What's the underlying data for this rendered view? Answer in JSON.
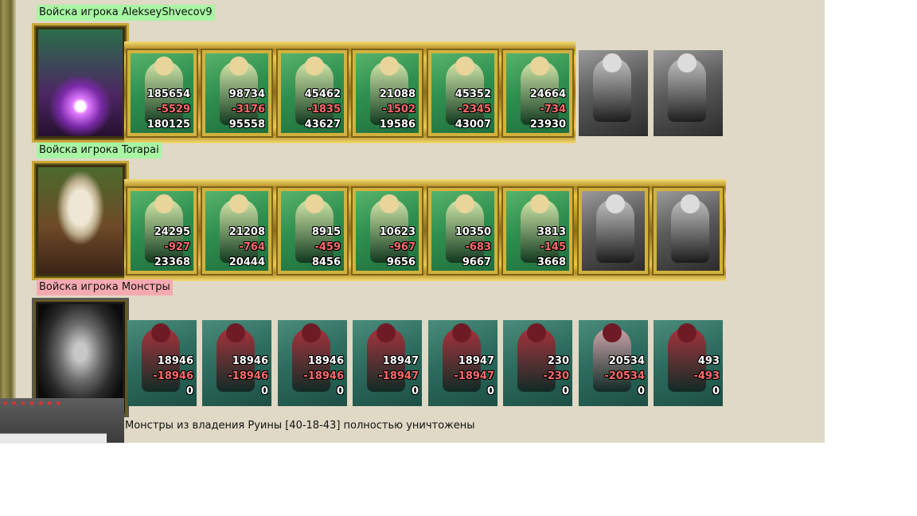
{
  "colors": {
    "panel_bg": "#dfd9c5",
    "label_green": "#a8f5a4",
    "label_pink": "#f5aab0",
    "number_white": "#ffffff",
    "number_red": "#ff6a6a",
    "gold_frame": "#d2b23d"
  },
  "armies": [
    {
      "label": "Войска игрока AlekseyShvecov9",
      "label_color": "green",
      "portrait_icon": "dark-elf-hero-portrait-icon",
      "units": [
        {
          "icon": "dwarf-warrior-icon",
          "start": "185654",
          "loss": "-5529",
          "left": "180125",
          "framed": true
        },
        {
          "icon": "blade-dancer-icon",
          "start": "98734",
          "loss": "-3176",
          "left": "95558",
          "framed": true
        },
        {
          "icon": "elf-guardian-icon",
          "start": "45462",
          "loss": "-1835",
          "left": "43627",
          "framed": true
        },
        {
          "icon": "griffin-icon",
          "start": "21088",
          "loss": "-1502",
          "left": "19586",
          "framed": true
        },
        {
          "icon": "elf-archer-icon",
          "start": "45352",
          "loss": "-2345",
          "left": "43007",
          "framed": true
        },
        {
          "icon": "druid-icon",
          "start": "24664",
          "loss": "-734",
          "left": "23930",
          "framed": true
        },
        {
          "icon": "monk-unit-grey-icon",
          "framed": false
        },
        {
          "icon": "elder-druid-grey-icon",
          "framed": false
        }
      ]
    },
    {
      "label": "Войска игрока Torapai",
      "label_color": "green",
      "portrait_icon": "barbarian-skull-hero-portrait-icon",
      "units": [
        {
          "icon": "dwarf-warrior-icon",
          "start": "24295",
          "loss": "-927",
          "left": "23368",
          "framed": true
        },
        {
          "icon": "blade-dancer-icon",
          "start": "21208",
          "loss": "-764",
          "left": "20444",
          "framed": true
        },
        {
          "icon": "elf-guardian-icon",
          "start": "8915",
          "loss": "-459",
          "left": "8456",
          "framed": true
        },
        {
          "icon": "griffin-icon",
          "start": "10623",
          "loss": "-967",
          "left": "9656",
          "framed": true
        },
        {
          "icon": "elf-archer-icon",
          "start": "10350",
          "loss": "-683",
          "left": "9667",
          "framed": true
        },
        {
          "icon": "druid-icon",
          "start": "3813",
          "loss": "-145",
          "left": "3668",
          "framed": true
        },
        {
          "icon": "monk-unit-grey-icon",
          "framed": true
        },
        {
          "icon": "elder-druid-grey-icon",
          "framed": true
        }
      ]
    },
    {
      "label": "Войска игрока Монстры",
      "label_color": "pink",
      "portrait_icon": "monster-demon-mask-portrait-icon",
      "units": [
        {
          "icon": "troll-monster-icon",
          "start": "18946",
          "loss": "-18946",
          "left": "0",
          "framed": false
        },
        {
          "icon": "golem-monster-icon",
          "start": "18946",
          "loss": "-18946",
          "left": "0",
          "framed": false
        },
        {
          "icon": "orc-shaman-monster-icon",
          "start": "18946",
          "loss": "-18946",
          "left": "0",
          "framed": false
        },
        {
          "icon": "gargoyle-monster-icon",
          "start": "18947",
          "loss": "-18947",
          "left": "0",
          "framed": false
        },
        {
          "icon": "spider-monster-icon",
          "start": "18947",
          "loss": "-18947",
          "left": "0",
          "framed": false
        },
        {
          "icon": "red-demon-monster-icon",
          "start": "230",
          "loss": "-230",
          "left": "0",
          "framed": false
        },
        {
          "icon": "crystal-golem-monster-icon",
          "start": "20534",
          "loss": "-20534",
          "left": "0",
          "framed": false
        },
        {
          "icon": "lich-monster-icon",
          "start": "493",
          "loss": "-493",
          "left": "0",
          "framed": false
        }
      ]
    }
  ],
  "result_message": "Монстры из владения Руины [40-18-43] полностью уничтожены"
}
